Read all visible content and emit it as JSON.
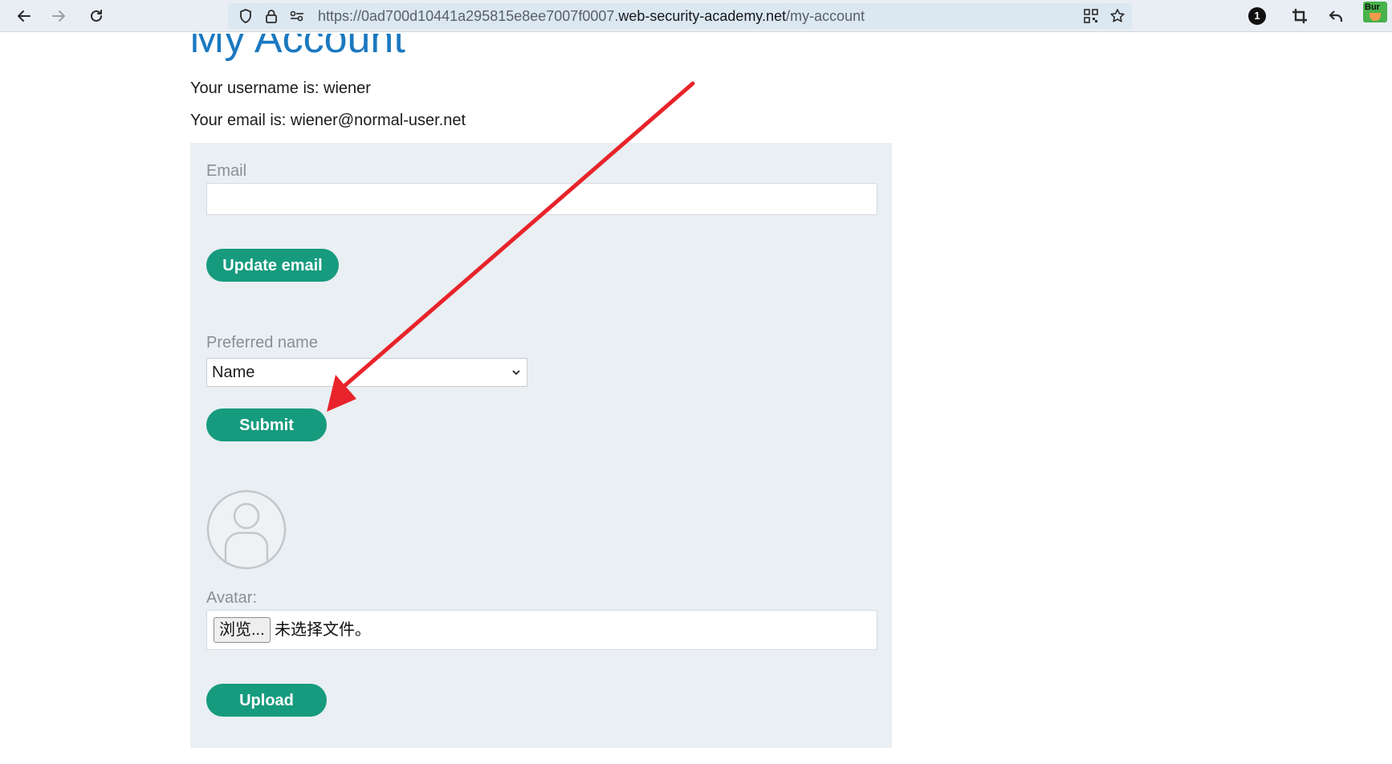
{
  "browser": {
    "url_prefix": "https://0ad700d10441a295815e8ee7007f0007.",
    "url_host": "web-security-academy.net",
    "url_path": "/my-account",
    "extension_badge": "1",
    "burp_label": "Bur"
  },
  "page": {
    "title": "My Account",
    "username_line": "Your username is: wiener",
    "email_line": "Your email is: wiener@normal-user.net"
  },
  "form": {
    "email_label": "Email",
    "email_value": "",
    "update_email_label": "Update email",
    "preferred_name_label": "Preferred name",
    "preferred_name_selected": "Name",
    "submit_label": "Submit",
    "avatar_label": "Avatar:",
    "browse_label": "浏览...",
    "file_status": "未选择文件。",
    "upload_label": "Upload"
  },
  "colors": {
    "accent_button": "#169b7e",
    "title_blue": "#1b79c0",
    "panel_bg": "#e9eff2",
    "annotation_arrow": "#e8232b"
  },
  "icons": [
    "back-icon",
    "forward-icon",
    "reload-icon",
    "shield-icon",
    "lock-icon",
    "permissions-icon",
    "qr-code-icon",
    "bookmark-star-icon",
    "crop-icon",
    "undo-icon",
    "burp-extension-icon",
    "avatar-placeholder-icon"
  ]
}
